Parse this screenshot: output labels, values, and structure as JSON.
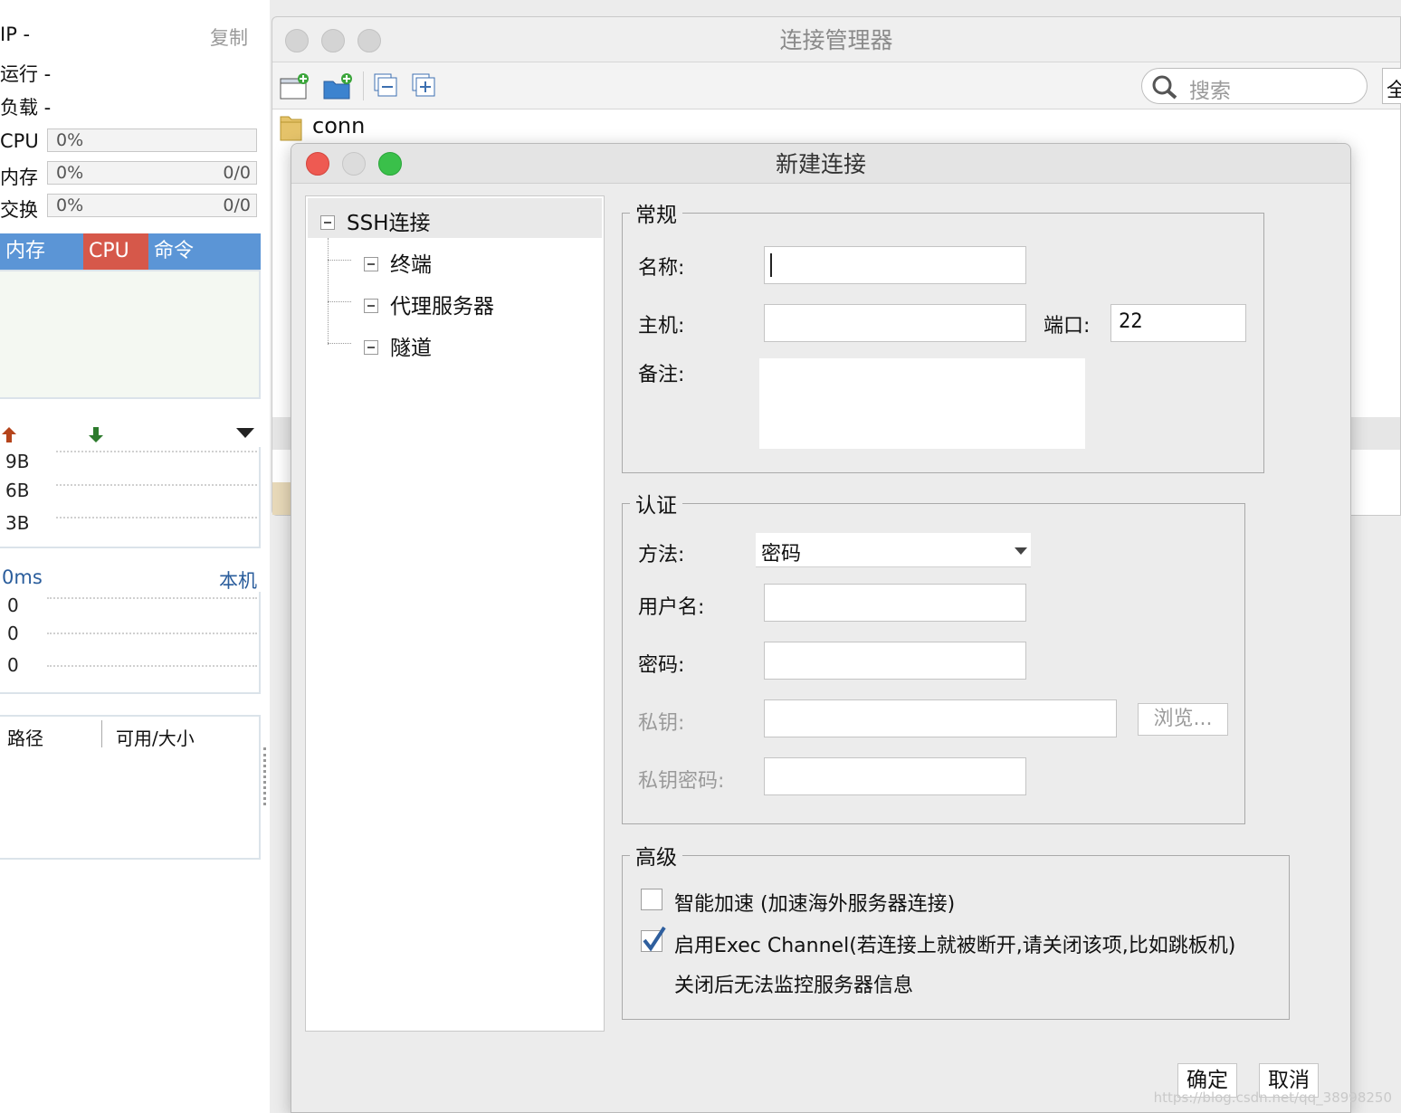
{
  "monitor": {
    "ip_label": "IP  -",
    "copy_label": "复制",
    "uptime_label": "运行 -",
    "load_label": "负载 -",
    "cpu": {
      "label": "CPU",
      "percent": "0%"
    },
    "memory": {
      "label": "内存",
      "percent": "0%",
      "ratio": "0/0"
    },
    "swap": {
      "label": "交换",
      "percent": "0%",
      "ratio": "0/0"
    },
    "tabs": [
      {
        "label": "内存",
        "color": "#5b95d6"
      },
      {
        "label": "CPU",
        "color": "#d6584a"
      },
      {
        "label": "命令",
        "color": "#5b95d6"
      }
    ],
    "network": {
      "up_color": "#b5441b",
      "down_color": "#2c7a2c",
      "ticks": [
        "9B",
        "6B",
        "3B"
      ]
    },
    "latency": {
      "label": "0ms",
      "host_label": "本机",
      "ticks": [
        "0",
        "0",
        "0"
      ]
    },
    "disk": {
      "path_header": "路径",
      "size_header": "可用/大小"
    }
  },
  "manager": {
    "title": "连接管理器",
    "search_placeholder": "搜索",
    "side_button": "全",
    "folder_name": "conn"
  },
  "dialog": {
    "title": "新建连接",
    "tree": {
      "root": "SSH连接",
      "children": [
        "终端",
        "代理服务器",
        "隧道"
      ]
    },
    "general": {
      "legend": "常规",
      "name_label": "名称:",
      "name_value": "",
      "host_label": "主机:",
      "host_value": "",
      "port_label": "端口:",
      "port_value": "22",
      "note_label": "备注:"
    },
    "auth": {
      "legend": "认证",
      "method_label": "方法:",
      "method_value": "密码",
      "username_label": "用户名:",
      "password_label": "密码:",
      "private_key_label": "私钥:",
      "browse_label": "浏览...",
      "key_password_label": "私钥密码:"
    },
    "advanced": {
      "legend": "高级",
      "smart_accel_label": "智能加速 (加速海外服务器连接)",
      "smart_accel_checked": false,
      "exec_channel_label": "启用Exec Channel(若连接上就被断开,请关闭该项,比如跳板机)",
      "exec_channel_checked": true,
      "exec_channel_note": "关闭后无法监控服务器信息"
    },
    "ok_label": "确定",
    "cancel_label": "取消"
  },
  "watermark": "https://blog.csdn.net/qq_38998250"
}
